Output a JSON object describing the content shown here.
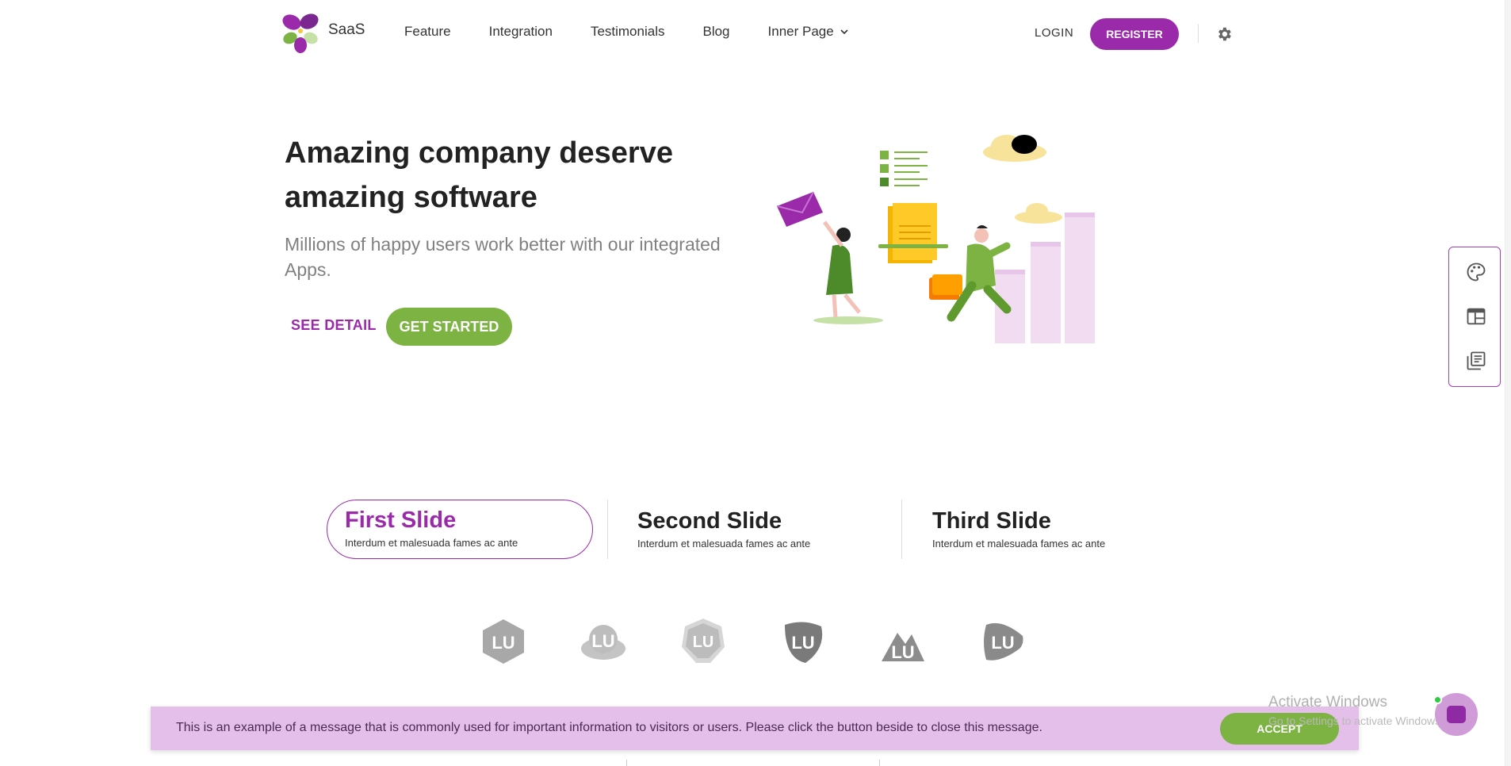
{
  "brand": {
    "name": "SaaS"
  },
  "nav": {
    "items": [
      {
        "label": "Feature"
      },
      {
        "label": "Integration"
      },
      {
        "label": "Testimonials"
      },
      {
        "label": "Blog"
      },
      {
        "label": "Inner Page"
      }
    ],
    "login": "LOGIN",
    "register": "REGISTER"
  },
  "hero": {
    "title": "Amazing company deserve amazing software",
    "subtitle": "Millions of happy users work better with our integrated Apps.",
    "see_detail": "SEE DETAIL",
    "get_started": "GET STARTED"
  },
  "slides": [
    {
      "title": "First Slide",
      "subtitle": "Interdum et malesuada fames ac ante",
      "active": true
    },
    {
      "title": "Second Slide",
      "subtitle": "Interdum et malesuada fames ac ante",
      "active": false
    },
    {
      "title": "Third Slide",
      "subtitle": "Interdum et malesuada fames ac ante",
      "active": false
    }
  ],
  "client_logos": [
    "LU",
    "LU",
    "LU",
    "LU",
    "LU",
    "LU"
  ],
  "side_panel": {
    "icons": [
      "palette-icon",
      "layout-icon",
      "library-icon"
    ]
  },
  "cookie": {
    "message": "This is an example of a message that is commonly used for important information to visitors or users. Please click the button beside to close this message.",
    "accept": "ACCEPT"
  },
  "os_overlay": {
    "title": "Activate Windows",
    "subtitle": "Go to Settings to activate Windows."
  },
  "colors": {
    "primary": "#9a2aaa",
    "secondary": "#7cb342",
    "cookie_bg": "#e4bfea"
  }
}
